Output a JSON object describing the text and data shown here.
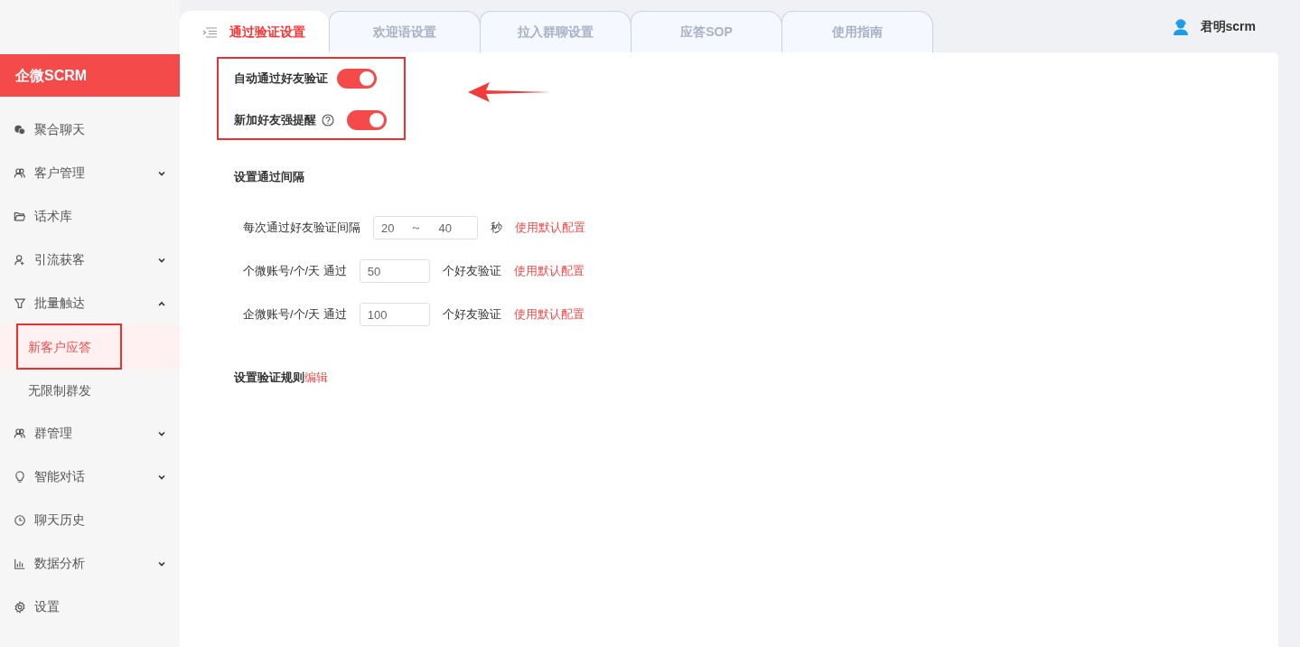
{
  "sidebar": {
    "logo": "企微SCRM",
    "items": [
      {
        "label": "聚合聊天"
      },
      {
        "label": "客户管理",
        "expanded": false
      },
      {
        "label": "话术库"
      },
      {
        "label": "引流获客",
        "expanded": false
      },
      {
        "label": "批量触达",
        "expanded": true,
        "children": [
          {
            "label": "新客户应答",
            "selected": true
          },
          {
            "label": "无限制群发",
            "selected": false
          }
        ]
      },
      {
        "label": "群管理",
        "expanded": false
      },
      {
        "label": "智能对话",
        "expanded": false
      },
      {
        "label": "聊天历史"
      },
      {
        "label": "数据分析",
        "expanded": false
      },
      {
        "label": "设置"
      }
    ]
  },
  "tabs": [
    {
      "label": "通过验证设置",
      "selected": true
    },
    {
      "label": "欢迎语设置",
      "selected": false
    },
    {
      "label": "拉入群聊设置",
      "selected": false
    },
    {
      "label": "应答SOP",
      "selected": false
    },
    {
      "label": "使用指南",
      "selected": false
    }
  ],
  "user": {
    "name": "君明scrm"
  },
  "toggles": [
    {
      "label": "自动通过好友验证",
      "help": false,
      "on": true
    },
    {
      "label": "新加好友强提醒",
      "help": true,
      "on": true
    }
  ],
  "interval_section": {
    "title": "设置通过间隔",
    "rows": [
      {
        "label": "每次通过好友验证间隔",
        "values": [
          "20",
          "40"
        ],
        "separator": "～",
        "unit": "秒",
        "link": "使用默认配置"
      },
      {
        "label": "个微账号/个/天 通过",
        "values": [
          "50"
        ],
        "unit": "个好友验证",
        "link": "使用默认配置"
      },
      {
        "label": "企微账号/个/天 通过",
        "values": [
          "100"
        ],
        "unit": "个好友验证",
        "link": "使用默认配置"
      }
    ]
  },
  "rules": {
    "title": "设置验证规则",
    "link": "编辑"
  }
}
